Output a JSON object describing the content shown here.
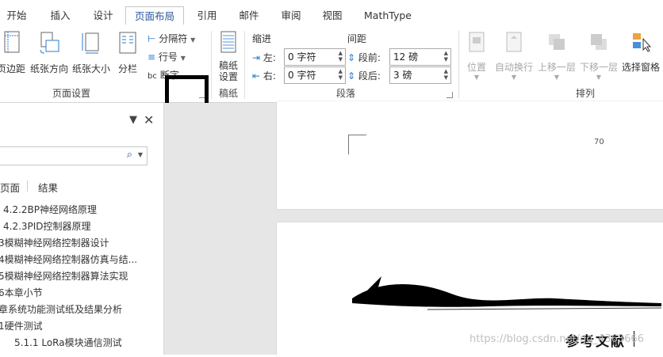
{
  "tabs": [
    "开始",
    "插入",
    "设计",
    "页面布局",
    "引用",
    "邮件",
    "审阅",
    "视图",
    "MathType"
  ],
  "active_tab": "页面布局",
  "page_setup": {
    "margins": "页边距",
    "orientation": "纸张方向",
    "size": "纸张大小",
    "columns": "分栏",
    "breaks": "分隔符",
    "line_numbers": "行号",
    "hyphenation": "断字",
    "group_label": "页面设置"
  },
  "draft": {
    "button": "稿纸设置",
    "line1": "稿纸",
    "line2": "设置",
    "group_label": "稿纸"
  },
  "paragraph": {
    "indent_header": "缩进",
    "spacing_header": "间距",
    "left_label": "左:",
    "left_value": "0 字符",
    "right_label": "右:",
    "right_value": "0 字符",
    "before_label": "段前:",
    "before_value": "12 磅",
    "after_label": "段后:",
    "after_value": "3 磅",
    "group_label": "段落"
  },
  "arrange": {
    "position": "位置",
    "wrap": "自动换行",
    "forward": "上移一层",
    "backward": "下移一层",
    "selection_pane": "选择窗格",
    "group_label": "排列"
  },
  "nav_pane": {
    "tab_pages": "页面",
    "tab_results": "结果",
    "items": [
      "4.2.2BP神经网络原理",
      "4.2.3PID控制器原理",
      "3模糊神经网络控制器设计",
      "4模糊神经网络控制器仿真与结...",
      "5模糊神经网络控制器算法实现",
      "6本章小节",
      "章系统功能测试纸及结果分析",
      "1硬件测试",
      "5.1.1 LoRa模块通信测试"
    ]
  },
  "document": {
    "page_number": "70",
    "reference_heading": "参考文献"
  },
  "watermark": "https://blog.csdn.net/qq_4363666"
}
